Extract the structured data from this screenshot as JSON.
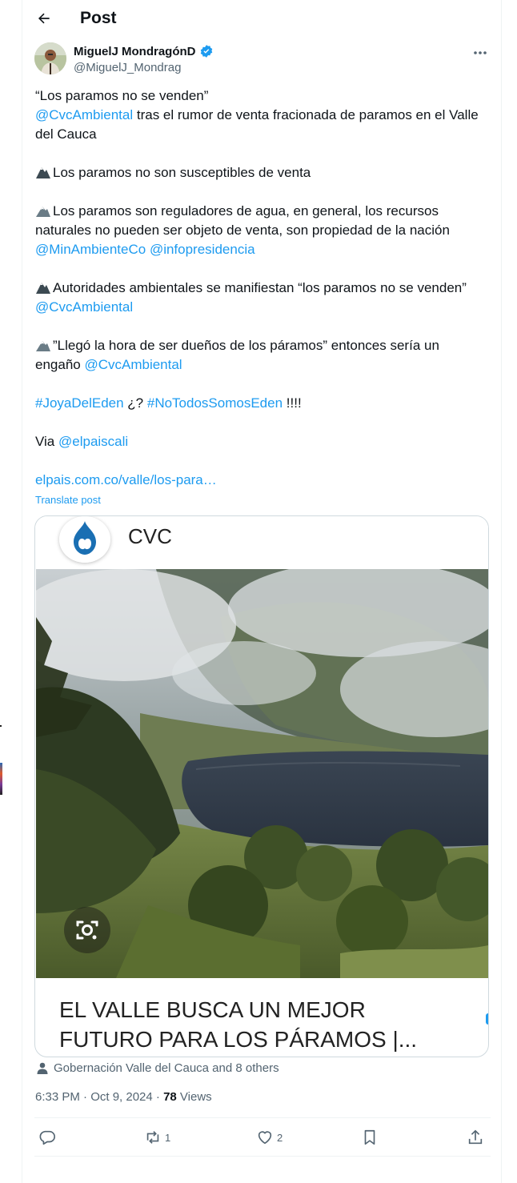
{
  "header": {
    "title": "Post"
  },
  "author": {
    "name": "MiguelJ MondragónD",
    "handle": "@MiguelJ_Mondrag",
    "verified": true
  },
  "post": {
    "l1": "“Los paramos no se venden”",
    "l2_mention": "@CvcAmbiental",
    "l2_text": " tras el rumor de venta fracionada de paramos en el Valle",
    "l3": "del Cauca",
    "l4": "Los paramos no son susceptibles de venta",
    "l5": "Los paramos son reguladores de agua, en general, los recursos",
    "l6": "naturales no pueden ser objeto de venta, son propiedad de la nación",
    "l7_m1": "@MinAmbienteCo",
    "l7_m2": "@infopresidencia",
    "l8": "Autoridades ambientales se manifiestan “los paramos no se venden”",
    "l9_mention": "@CvcAmbiental",
    "l10": "”Llegó la hora de ser dueños de los páramos” entonces sería un",
    "l11_text": "engaño ",
    "l11_mention": "@CvcAmbiental",
    "l12_tag1": "#JoyaDelEden",
    "l12_mid": " ¿? ",
    "l12_tag2": "#NoTodosSomosEden",
    "l12_end": " !!!!",
    "l13_text": "Via ",
    "l13_mention": "@elpaiscali",
    "l14_link": "elpais.com.co/valle/los-para…",
    "translate": "Translate post"
  },
  "card": {
    "source": "CVC",
    "title_l1": "EL VALLE BUSCA UN MEJOR",
    "title_l2": "FUTURO PARA LOS PÁRAMOS |..."
  },
  "social_context": "Gobernación Valle del Cauca and 8 others",
  "meta": {
    "time": "6:33 PM · Oct 9, 2024 · ",
    "views_count": "78",
    "views_label": " Views"
  },
  "actions": {
    "replies": "",
    "reposts": "1",
    "likes": "2"
  },
  "colors": {
    "link": "#1d9bf0",
    "text": "#0f1419",
    "muted": "#536471",
    "border": "#cfd9de"
  }
}
